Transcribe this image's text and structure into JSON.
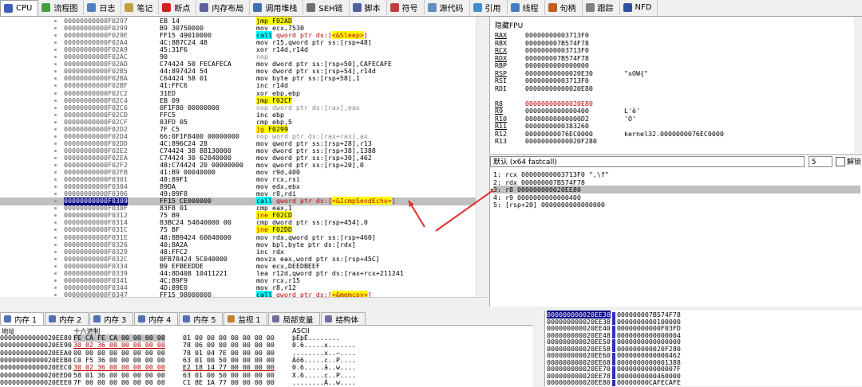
{
  "tabs": [
    {
      "label": "CPU",
      "icon": "cpu-icon",
      "color": "#4060c0",
      "active": true
    },
    {
      "label": "流程图",
      "icon": "graph-icon",
      "color": "#40a040"
    },
    {
      "label": "日志",
      "icon": "log-icon",
      "color": "#5080c0"
    },
    {
      "label": "笔记",
      "icon": "notes-icon",
      "color": "#c0a040"
    },
    {
      "label": "断点",
      "icon": "breakpoint-icon",
      "color": "#d02020"
    },
    {
      "label": "内存布局",
      "icon": "memory-map-icon",
      "color": "#6060a0"
    },
    {
      "label": "调用堆栈",
      "icon": "call-stack-icon",
      "color": "#4070b0"
    },
    {
      "label": "SEH链",
      "icon": "seh-icon",
      "color": "#707070"
    },
    {
      "label": "脚本",
      "icon": "script-icon",
      "color": "#5060a0"
    },
    {
      "label": "符号",
      "icon": "symbol-icon",
      "color": "#c04040"
    },
    {
      "label": "源代码",
      "icon": "source-icon",
      "color": "#6090c0"
    },
    {
      "label": "引用",
      "icon": "reference-icon",
      "color": "#4090d0"
    },
    {
      "label": "线程",
      "icon": "thread-icon",
      "color": "#4080c0"
    },
    {
      "label": "句柄",
      "icon": "handle-icon",
      "color": "#c06020"
    },
    {
      "label": "跟踪",
      "icon": "trace-icon",
      "color": "#808080"
    },
    {
      "label": "NFD",
      "icon": "nfd-icon",
      "color": "#3050a0"
    }
  ],
  "disasm": [
    {
      "addr": "00000000000F0297",
      "bytes": "EB 14",
      "instr": "jmp F02AD",
      "kind": "jmp"
    },
    {
      "addr": "00000000000F0299",
      "bytes": "B9 30750000",
      "instr": "mov ecx,7530",
      "kind": "plain"
    },
    {
      "addr": "00000000000F029E",
      "bytes": "FF15 49010000",
      "instr": "call qword ptr ds:[<&Sleep>]",
      "kind": "call"
    },
    {
      "addr": "00000000000F02A4",
      "bytes": "4C:8B7C24 48",
      "instr": "mov r15,qword ptr ss:[rsp+48]",
      "kind": "plain"
    },
    {
      "addr": "00000000000F02A9",
      "bytes": "45:31F6",
      "instr": "xor r14d,r14d",
      "kind": "plain"
    },
    {
      "addr": "00000000000F02AC",
      "bytes": "90",
      "instr": "nop",
      "kind": "nop"
    },
    {
      "addr": "00000000000F02AD",
      "bytes": "C74424 50 FECAFECA",
      "instr": "mov dword ptr ss:[rsp+50],CAFECAFE",
      "kind": "plain"
    },
    {
      "addr": "00000000000F02B5",
      "bytes": "44:897424 54",
      "instr": "mov dword ptr ss:[rsp+54],r14d",
      "kind": "plain"
    },
    {
      "addr": "00000000000F02BA",
      "bytes": "C64424 58 01",
      "instr": "mov byte ptr ss:[rsp+58],1",
      "kind": "plain"
    },
    {
      "addr": "00000000000F02BF",
      "bytes": "41:FFC6",
      "instr": "inc r14d",
      "kind": "plain"
    },
    {
      "addr": "00000000000F02C2",
      "bytes": "31ED",
      "instr": "xor ebp,ebp",
      "kind": "plain"
    },
    {
      "addr": "00000000000F02C4",
      "bytes": "EB 09",
      "instr": "jmp F02CF",
      "kind": "jmp"
    },
    {
      "addr": "00000000000F02C6",
      "bytes": "0F1F80 00000000",
      "instr": "nop dword ptr ds:[rax],eax",
      "kind": "nop"
    },
    {
      "addr": "00000000000F02CD",
      "bytes": "FFC5",
      "instr": "inc ebp",
      "kind": "plain"
    },
    {
      "addr": "00000000000F02CF",
      "bytes": "83FD 05",
      "instr": "cmp ebp,5",
      "kind": "plain"
    },
    {
      "addr": "00000000000F02D2",
      "bytes": "7F C5",
      "instr": "jg F0299",
      "kind": "jcc"
    },
    {
      "addr": "00000000000F02D4",
      "bytes": "66:0F1F8400 00000000",
      "instr": "nop word ptr ds:[rax+rax],ax",
      "kind": "nop"
    },
    {
      "addr": "00000000000F02DD",
      "bytes": "4C:896C24 28",
      "instr": "mov qword ptr ss:[rsp+28],r13",
      "kind": "plain"
    },
    {
      "addr": "00000000000F02E2",
      "bytes": "C74424 38 88130000",
      "instr": "mov dword ptr ss:[rsp+38],1388",
      "kind": "plain"
    },
    {
      "addr": "00000000000F02EA",
      "bytes": "C74424 30 62040000",
      "instr": "mov dword ptr ss:[rsp+30],462",
      "kind": "plain"
    },
    {
      "addr": "00000000000F02F2",
      "bytes": "48:C74424 20 00000000",
      "instr": "mov qword ptr ss:[rsp+20],0",
      "kind": "plain"
    },
    {
      "addr": "00000000000F02FB",
      "bytes": "41:B9 00040000",
      "instr": "mov r9d,400",
      "kind": "plain"
    },
    {
      "addr": "00000000000F0301",
      "bytes": "48:89F1",
      "instr": "mov rcx,rsi",
      "kind": "plain"
    },
    {
      "addr": "00000000000F0304",
      "bytes": "89DA",
      "instr": "mov edx,ebx",
      "kind": "plain"
    },
    {
      "addr": "00000000000F0306",
      "bytes": "49:89F8",
      "instr": "mov r8,rdi",
      "kind": "plain"
    },
    {
      "addr": "00000000000F0309",
      "bytes": "FF15 CE000000",
      "instr": "call qword ptr ds:[<&IcmpSendEcho>]",
      "kind": "call",
      "current": true
    },
    {
      "addr": "00000000000F030F",
      "bytes": "83F8 01",
      "instr": "cmp eax,1",
      "kind": "plain"
    },
    {
      "addr": "00000000000F0312",
      "bytes": "75 B9",
      "instr": "jne F02CD",
      "kind": "jcc"
    },
    {
      "addr": "00000000000F0314",
      "bytes": "83BC24 54040000 00",
      "instr": "cmp dword ptr ss:[rsp+454],0",
      "kind": "plain"
    },
    {
      "addr": "00000000000F031C",
      "bytes": "75 BF",
      "instr": "jne F02DD",
      "kind": "jcc"
    },
    {
      "addr": "00000000000F031E",
      "bytes": "48:8B9424 60040000",
      "instr": "mov rdx,qword ptr ss:[rsp+460]",
      "kind": "plain"
    },
    {
      "addr": "00000000000F0326",
      "bytes": "40:8A2A",
      "instr": "mov bpl,byte ptr ds:[rdx]",
      "kind": "plain"
    },
    {
      "addr": "00000000000F0329",
      "bytes": "48:FFC2",
      "instr": "inc rdx",
      "kind": "plain"
    },
    {
      "addr": "00000000000F032C",
      "bytes": "0FB78424 5C040000",
      "instr": "movzx eax,word ptr ss:[rsp+45C]",
      "kind": "plain"
    },
    {
      "addr": "00000000000F0334",
      "bytes": "B9 EFBEEDDE",
      "instr": "mov ecx,DEEDBEEF",
      "kind": "plain"
    },
    {
      "addr": "00000000000F0339",
      "bytes": "44:8D408 10411221",
      "instr": "lea r12d,qword ptr ds:[rax+rcx+211241",
      "kind": "plain"
    },
    {
      "addr": "00000000000F0341",
      "bytes": "4C:89F9",
      "instr": "mov rcx,r15",
      "kind": "plain"
    },
    {
      "addr": "00000000000F0344",
      "bytes": "4D:89E0",
      "instr": "mov r8,r12",
      "kind": "plain"
    },
    {
      "addr": "00000000000F0347",
      "bytes": "FF15 98000000",
      "instr": "call qword ptr ds:[<&memcpy>]",
      "kind": "call"
    }
  ],
  "rip_label": "RIP",
  "registers": {
    "title": "隐藏FPU",
    "rows": [
      {
        "name": "RAX",
        "value": "00000000003713F0",
        "comment": "",
        "ul": true
      },
      {
        "name": "RBX",
        "value": "000000007B574F78",
        "comment": "",
        "ul": false
      },
      {
        "name": "RCX",
        "value": "00000000003713F0",
        "comment": "",
        "ul": true
      },
      {
        "name": "RDX",
        "value": "000000007B574F78",
        "comment": "",
        "ul": true
      },
      {
        "name": "RBP",
        "value": "0000000000000000",
        "comment": "",
        "ul": false
      },
      {
        "name": "RSP",
        "value": "00000000000020E30",
        "comment": "\"xOW{\"",
        "ul": true
      },
      {
        "name": "RSI",
        "value": "00000000003713F0",
        "comment": "",
        "ul": false
      },
      {
        "name": "RDI",
        "value": "00000000000020E80",
        "comment": "",
        "ul": false
      },
      {
        "name": "",
        "value": "",
        "comment": "",
        "ul": false
      },
      {
        "name": "R8",
        "value": "00000000000020E80",
        "comment": "",
        "ul": true,
        "changed": true
      },
      {
        "name": "R9",
        "value": "0000000000000400",
        "comment": "L'è'",
        "ul": true
      },
      {
        "name": "R10",
        "value": "00000000000000D2",
        "comment": "'Ò'",
        "ul": true
      },
      {
        "name": "R11",
        "value": "0000000000383260",
        "comment": "",
        "ul": true
      },
      {
        "name": "R12",
        "value": "00000000076EC0000",
        "comment": "kernel32.0000000076EC0000",
        "ul": false
      },
      {
        "name": "R13",
        "value": "00000000000020F280",
        "comment": "",
        "ul": false
      }
    ]
  },
  "callconv": {
    "select": "默认 (x64 fastcall)",
    "count": "5",
    "unlock_label": "解锁",
    "args": [
      "1: rcx 00000000003713F0 \",\\f\"",
      "2: rdx 000000007B574F78",
      "3: r8 000000000020EE80",
      "4: r9 0000000000000400",
      "5: [rsp+20] 0000000000000000"
    ]
  },
  "bottom_tabs": [
    {
      "label": "内存 1",
      "icon": "memory-icon",
      "active": true
    },
    {
      "label": "内存 2",
      "icon": "memory-icon"
    },
    {
      "label": "内存 3",
      "icon": "memory-icon"
    },
    {
      "label": "内存 4",
      "icon": "memory-icon"
    },
    {
      "label": "内存 5",
      "icon": "memory-icon"
    },
    {
      "label": "监视 1",
      "icon": "watch-icon"
    },
    {
      "label": "局部变量",
      "icon": "locals-icon"
    },
    {
      "label": "结构体",
      "icon": "struct-icon"
    }
  ],
  "dump": {
    "headers": {
      "addr": "地址",
      "hex": "十六进制",
      "ascii": "ASCII"
    },
    "rows": [
      {
        "addr": "00000000000020EE80",
        "hex1": "FE CA FE CA 00 00 00 00",
        "hex2": "01 00 00 00 00 00 00 00",
        "ascii": "þÊþÊ........"
      },
      {
        "addr": "00000000000020EE90",
        "hex1": "30 02 36 00 00 00 00 00",
        "hex2": "78 06 00 00 00 00 00 00",
        "ascii": "0.6.....x......."
      },
      {
        "addr": "00000000000020EEA0",
        "hex1": "00 00 00 00 00 00 00 00",
        "hex2": "78 01 04 7E 00 00 00 00",
        "ascii": "........x..~...."
      },
      {
        "addr": "00000000000020EEB0",
        "hex1": "C0 F5 36 00 00 00 00 00",
        "hex2": "63 01 00 50 00 00 00 00",
        "ascii": "Àõ6.....c..P...."
      },
      {
        "addr": "00000000000020EEC0",
        "hex1": "30 02 36 00 00 00 00 00",
        "hex2": "E2 18 14 77 00 00 00 00",
        "ascii": "0.6.....â..w...."
      },
      {
        "addr": "00000000000020EED0",
        "hex1": "58 01 36 00 00 00 00 00",
        "hex2": "63 01 00 50 00 00 00 00",
        "ascii": "X.6.....c..P...."
      },
      {
        "addr": "00000000000020EEE0",
        "hex1": "7F 00 00 00 00 00 00 00",
        "hex2": "C1 8E 1A 77 00 00 00 00",
        "ascii": "........Á..w...."
      }
    ]
  },
  "stack": [
    {
      "addr": "000000000020EE30",
      "val": "000000007B574F78",
      "sel": true
    },
    {
      "addr": "000000000020EE38",
      "val": "0000000000100000"
    },
    {
      "addr": "000000000020EE40",
      "val": "00000000000F03FD"
    },
    {
      "addr": "000000000020EE48",
      "val": "0000000000000004"
    },
    {
      "addr": "000000000020EE50",
      "val": "0000000000000000"
    },
    {
      "addr": "000000000020EE58",
      "val": "000000000020F280"
    },
    {
      "addr": "000000000020EE60",
      "val": "0000000000000462"
    },
    {
      "addr": "000000000020EE68",
      "val": "0000000000001388"
    },
    {
      "addr": "000000000020EE70",
      "val": "000000000000007F"
    },
    {
      "addr": "000000000020EE78",
      "val": "0000000000460000"
    },
    {
      "addr": "000000000020EE80",
      "val": "00000000CAFECAFE"
    }
  ],
  "colors": {
    "accent": "#0000ff",
    "changed": "#c00000",
    "call_bg": "#00ffff",
    "jmp_bg": "#ffff00",
    "arrow": "#e03030"
  }
}
